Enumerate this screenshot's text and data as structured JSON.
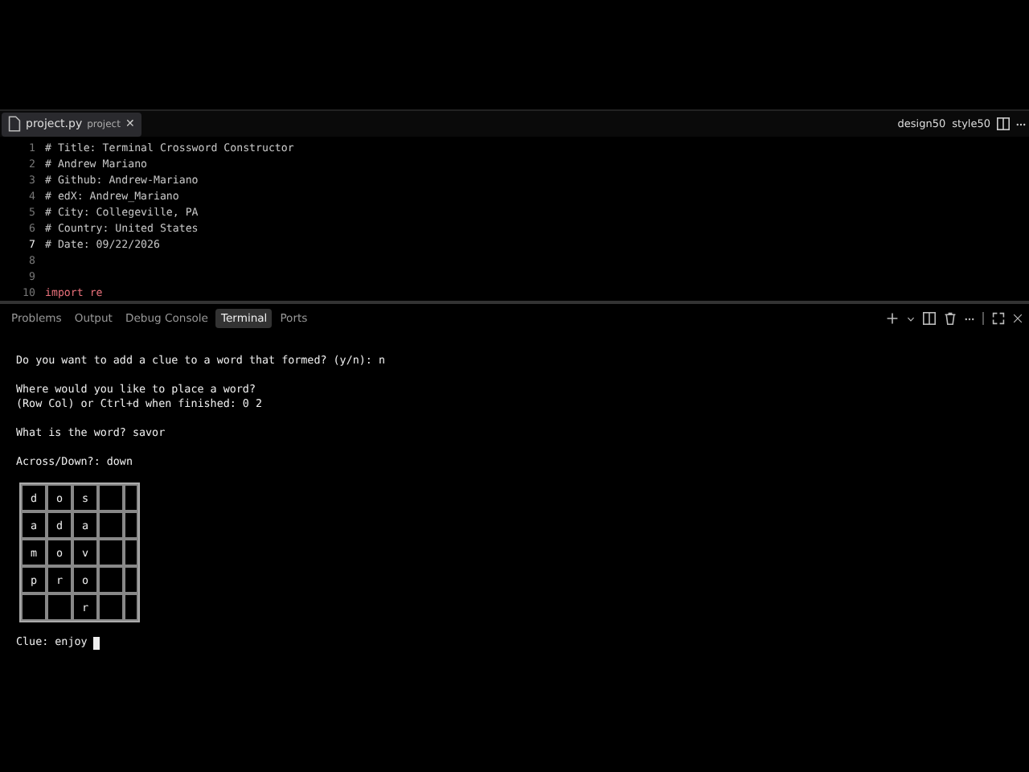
{
  "editor": {
    "tab": {
      "filename": "project.py",
      "hint": "project",
      "selected": true,
      "close": "✕"
    },
    "actions": [
      "design50",
      "style50"
    ],
    "lines": [
      {
        "number": "1",
        "current": false,
        "tokens": [
          {
            "text": "# Title: Terminal Crossword Constructor",
            "kind": "comment"
          }
        ]
      },
      {
        "number": "2",
        "current": false,
        "tokens": [
          {
            "text": "# Andrew Mariano",
            "kind": "comment"
          }
        ]
      },
      {
        "number": "3",
        "current": false,
        "tokens": [
          {
            "text": "# Github: Andrew-Mariano",
            "kind": "comment"
          }
        ]
      },
      {
        "number": "4",
        "current": false,
        "tokens": [
          {
            "text": "# edX: Andrew_Mariano",
            "kind": "comment"
          }
        ]
      },
      {
        "number": "5",
        "current": false,
        "tokens": [
          {
            "text": "# City: Collegeville, PA",
            "kind": "comment"
          }
        ]
      },
      {
        "number": "6",
        "current": false,
        "tokens": [
          {
            "text": "# Country: United States",
            "kind": "comment"
          }
        ]
      },
      {
        "number": "7",
        "current": true,
        "tokens": [
          {
            "text": "# Date: 09/22/2026",
            "kind": "comment"
          }
        ]
      },
      {
        "number": "8",
        "current": false
      },
      {
        "number": "9",
        "current": false
      },
      {
        "number": "10",
        "current": false,
        "tokens": [
          {
            "text": "import",
            "kind": "keyword"
          },
          {
            "text": "re",
            "kind": "plain"
          }
        ]
      }
    ]
  },
  "panel": {
    "tabs": [
      {
        "label": "Problems",
        "selected": false
      },
      {
        "label": "Output",
        "selected": false
      },
      {
        "label": "Debug Console",
        "selected": false
      },
      {
        "label": "Terminal",
        "selected": true
      },
      {
        "label": "Ports",
        "selected": false
      }
    ]
  },
  "terminal": {
    "blocks": [
      [
        "Do you want to add a clue to a word that formed? (y/n): n"
      ],
      [
        "Where would you like to place a word?",
        "(Row Col) or Ctrl+d when finished: 0 2"
      ],
      [
        "What is the word? savor"
      ],
      [
        "Across/Down?: down"
      ]
    ],
    "grid": [
      [
        {
          "kind": "letter",
          "letter": "d"
        },
        {
          "kind": "letter",
          "letter": "o"
        },
        {
          "kind": "letter",
          "letter": "s"
        },
        {
          "kind": "blank"
        },
        {
          "kind": "blank"
        }
      ],
      [
        {
          "kind": "letter",
          "letter": "a"
        },
        {
          "kind": "letter",
          "letter": "d"
        },
        {
          "kind": "letter",
          "letter": "a"
        },
        {
          "kind": "blank"
        },
        {
          "kind": "blank"
        }
      ],
      [
        {
          "kind": "letter",
          "letter": "m"
        },
        {
          "kind": "letter",
          "letter": "o"
        },
        {
          "kind": "letter",
          "letter": "v"
        },
        {
          "kind": "blank"
        },
        {
          "kind": "blank"
        }
      ],
      [
        {
          "kind": "letter",
          "letter": "p"
        },
        {
          "kind": "letter",
          "letter": "r"
        },
        {
          "kind": "letter",
          "letter": "o"
        },
        {
          "kind": "blank"
        },
        {
          "kind": "blank"
        }
      ],
      [
        {
          "kind": "blank"
        },
        {
          "kind": "blank"
        },
        {
          "kind": "letter",
          "letter": "r"
        },
        {
          "kind": "blank"
        },
        {
          "kind": "blank"
        }
      ]
    ],
    "prompt": "Clue: enjoy"
  }
}
